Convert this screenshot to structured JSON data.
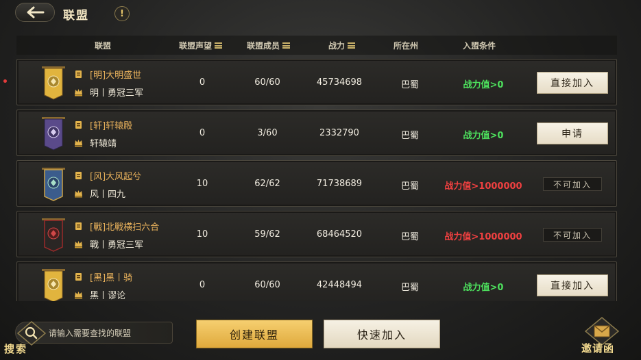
{
  "header": {
    "title": "联盟",
    "info_glyph": "!"
  },
  "columns": {
    "alliance": "联盟",
    "prestige": "联盟声望",
    "members": "联盟成员",
    "power": "战力",
    "region": "所在州",
    "condition": "入盟条件"
  },
  "rows": [
    {
      "alliance_name": "[明]大明盛世",
      "leader_name": "明丨勇冠三军",
      "prestige": "0",
      "members": "60/60",
      "power": "45734698",
      "region": "巴蜀",
      "condition": "战力值>0",
      "condition_status": "met",
      "action": "直接加入",
      "action_enabled": true,
      "banner_color": "#e1b43e"
    },
    {
      "alliance_name": "[轩]轩辕殿",
      "leader_name": "轩辕靖",
      "prestige": "0",
      "members": "3/60",
      "power": "2332790",
      "region": "巴蜀",
      "condition": "战力值>0",
      "condition_status": "met",
      "action": "申请",
      "action_enabled": true,
      "banner_color": "#5a4a8a"
    },
    {
      "alliance_name": "[风]大风起兮",
      "leader_name": "风丨四九",
      "prestige": "10",
      "members": "62/62",
      "power": "71738689",
      "region": "巴蜀",
      "condition": "战力值>1000000",
      "condition_status": "unmet",
      "action": "不可加入",
      "action_enabled": false,
      "banner_color": "#3b5c8c"
    },
    {
      "alliance_name": "[戰]北戰横扫六合",
      "leader_name": "戰丨勇冠三军",
      "prestige": "10",
      "members": "59/62",
      "power": "68464520",
      "region": "巴蜀",
      "condition": "战力值>1000000",
      "condition_status": "unmet",
      "action": "不可加入",
      "action_enabled": false,
      "banner_color": "#2a2624"
    },
    {
      "alliance_name": "[黑]黑丨骑",
      "leader_name": "黑丨谬论",
      "prestige": "0",
      "members": "60/60",
      "power": "42448494",
      "region": "巴蜀",
      "condition": "战力值>0",
      "condition_status": "met",
      "action": "直接加入",
      "action_enabled": true,
      "banner_color": "#e1b43e"
    }
  ],
  "bottom": {
    "search_label": "搜索",
    "search_placeholder": "请输入需要查找的联盟",
    "create_button": "创建联盟",
    "quick_join_button": "快速加入",
    "invite_label": "邀请函"
  },
  "colors": {
    "met": "#4de05d",
    "unmet": "#f04040",
    "accent": "#e9b25c"
  }
}
